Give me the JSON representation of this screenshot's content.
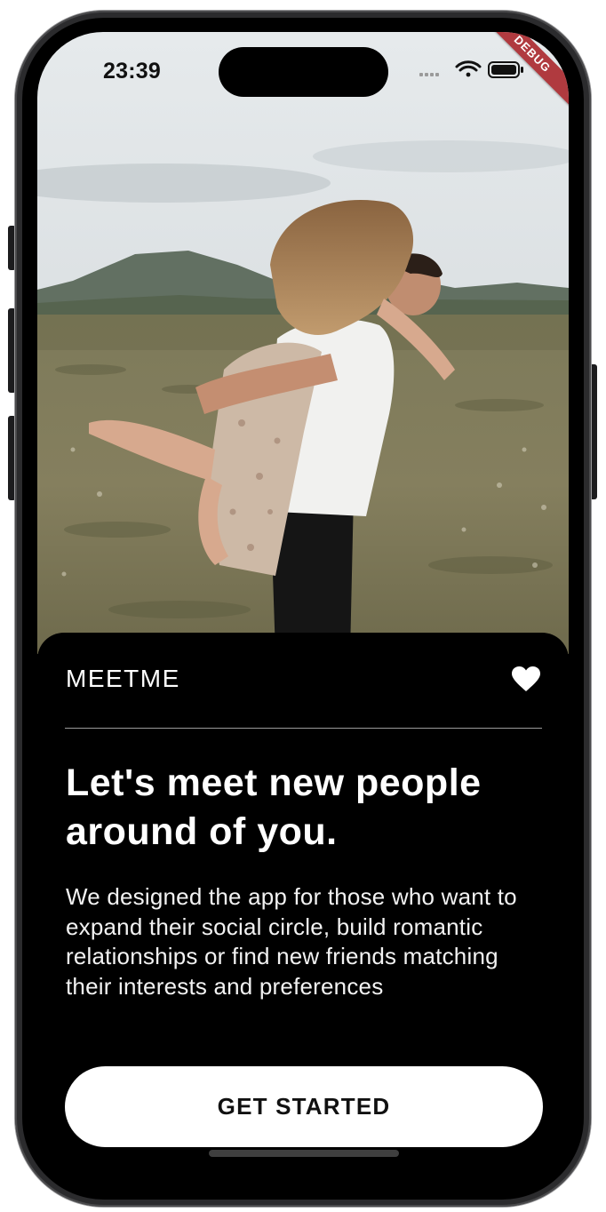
{
  "status_bar": {
    "time": "23:39",
    "icons": [
      "cellular-signal-icon",
      "wifi-icon",
      "battery-icon"
    ],
    "debug_label": "DEBUG"
  },
  "hero": {
    "image": "couple-embracing-in-meadow-photo"
  },
  "card": {
    "brand": "MEETME",
    "favorite_icon": "heart-icon",
    "headline": "Let's meet new people around of you.",
    "description": "We designed the app for those who want to expand their social circle, build romantic relationships or find new friends matching their interests and preferences",
    "cta_label": "GET STARTED"
  },
  "colors": {
    "card_background": "#000000",
    "text_primary": "#ffffff",
    "button_background": "#ffffff",
    "button_text": "#111111",
    "debug_ribbon": "#b03a3f"
  }
}
